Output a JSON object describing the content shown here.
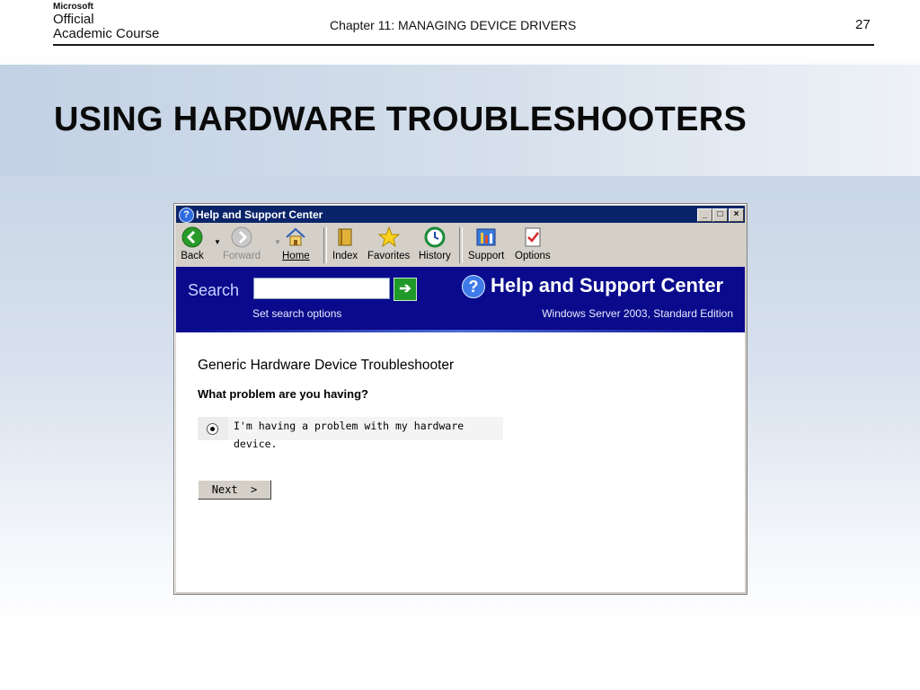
{
  "slide": {
    "logo_line0": "Microsoft",
    "logo_line1": "Official",
    "logo_line2": "Academic Course",
    "chapter": "Chapter 11: MANAGING DEVICE DRIVERS",
    "page_number": "27",
    "title": "USING HARDWARE TROUBLESHOOTERS"
  },
  "window": {
    "title": "Help and Support Center",
    "controls": {
      "minimize": "_",
      "maximize": "□",
      "close": "×"
    }
  },
  "toolbar": {
    "back": "Back",
    "forward": "Forward",
    "home": "Home",
    "index": "Index",
    "favorites": "Favorites",
    "history": "History",
    "support": "Support",
    "options": "Options"
  },
  "banner": {
    "search_label": "Search",
    "search_value": "",
    "set_search_options": "Set search options",
    "heading": "Help and Support Center",
    "edition": "Windows Server 2003, Standard Edition"
  },
  "content": {
    "heading": "Generic Hardware Device Troubleshooter",
    "question": "What problem are you having?",
    "option_text": "I'm having a problem with my hardware device.",
    "option_selected": true,
    "next_button": "Next  >"
  },
  "colors": {
    "titlebar": "#0a246a",
    "banner": "#0a0a8c",
    "window_chrome": "#d4d0c8"
  }
}
